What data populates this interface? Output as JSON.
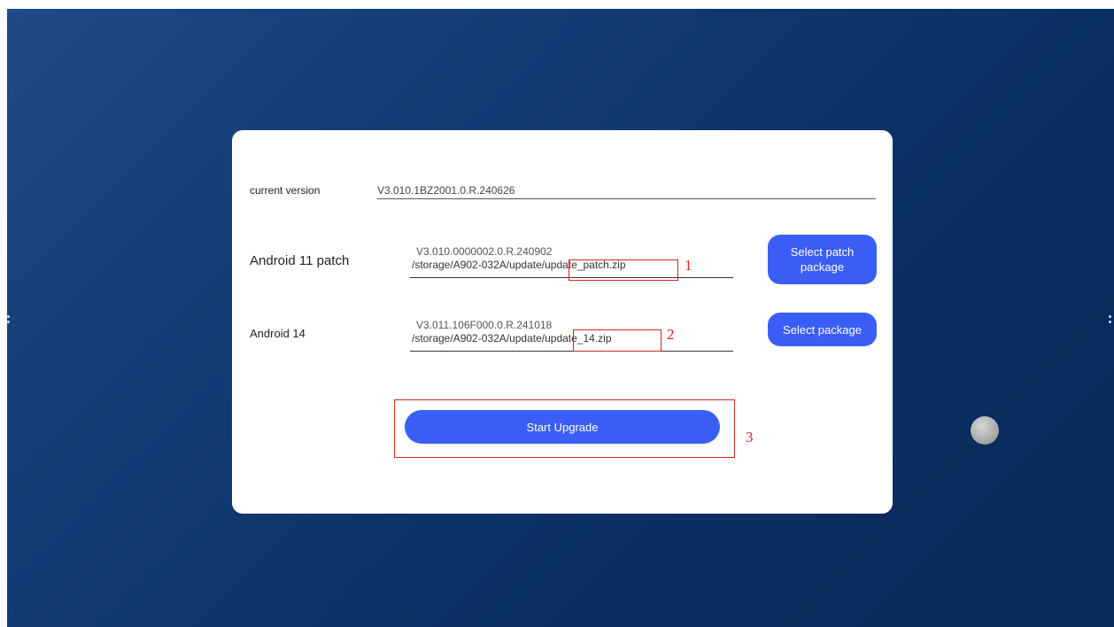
{
  "current_version": {
    "label": "current version",
    "value": "V3.010.1BZ2001.0.R.240626"
  },
  "android11_patch": {
    "label": "Android 11 patch",
    "version": "V3.010.0000002.0.R.240902",
    "path": "/storage/A902-032A/update/update_patch.zip",
    "button_label": "Select patch package"
  },
  "android14": {
    "label": "Android 14",
    "version": "V3.011.106F000.0.R.241018",
    "path": "/storage/A902-032A/update/update_14.zip",
    "button_label": "Select package"
  },
  "start_button_label": "Start Upgrade",
  "annotations": {
    "n1": "1",
    "n2": "2",
    "n3": "3",
    "color": "#d92222"
  },
  "colors": {
    "accent": "#3a5ef5",
    "background": "#123a73",
    "panel": "#ffffff"
  },
  "icons": {
    "floating_button": "floating-assist-icon"
  }
}
